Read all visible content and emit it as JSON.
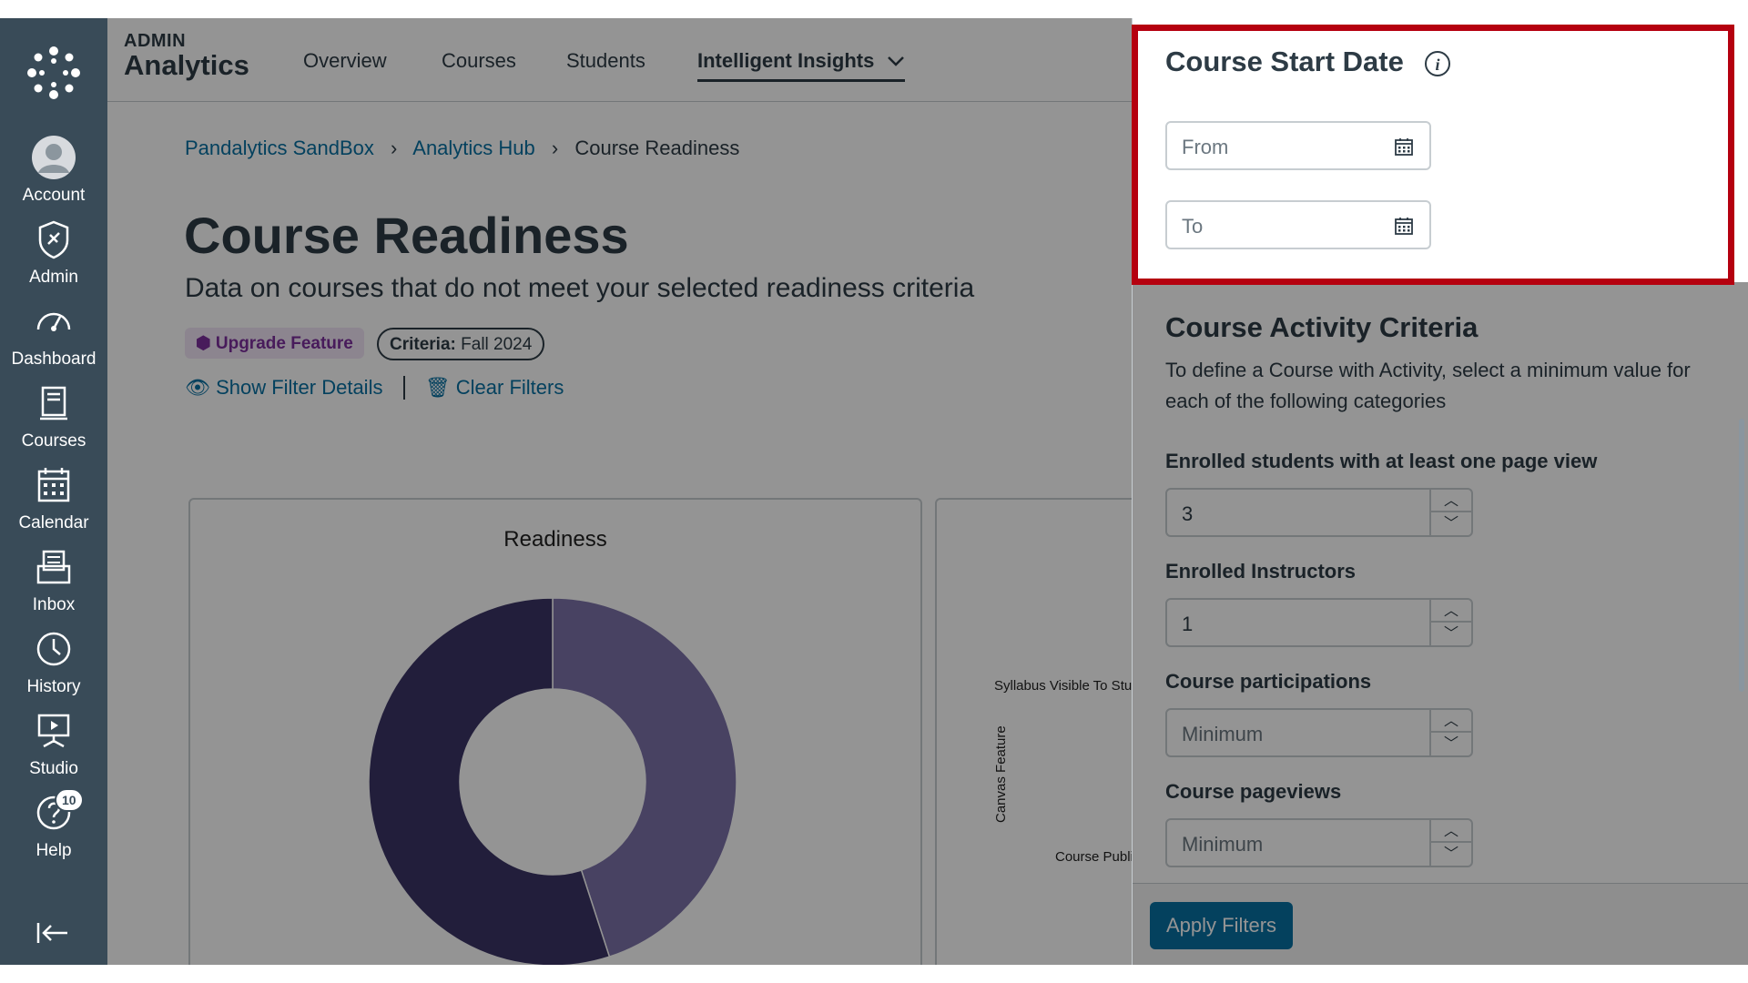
{
  "nav": {
    "items": [
      {
        "label": "Account",
        "icon": "account-icon"
      },
      {
        "label": "Admin",
        "icon": "admin-icon"
      },
      {
        "label": "Dashboard",
        "icon": "dashboard-icon"
      },
      {
        "label": "Courses",
        "icon": "courses-icon"
      },
      {
        "label": "Calendar",
        "icon": "calendar-icon"
      },
      {
        "label": "Inbox",
        "icon": "inbox-icon"
      },
      {
        "label": "History",
        "icon": "history-icon"
      },
      {
        "label": "Studio",
        "icon": "studio-icon"
      },
      {
        "label": "Help",
        "icon": "help-icon",
        "badge": "10"
      }
    ]
  },
  "header": {
    "brand_small": "ADMIN",
    "brand_big": "Analytics",
    "tabs": [
      "Overview",
      "Courses",
      "Students",
      "Intelligent Insights"
    ]
  },
  "breadcrumb": [
    "Pandalytics SandBox",
    "Analytics Hub",
    "Course Readiness"
  ],
  "page": {
    "title": "Course Readiness",
    "subtitle": "Data on courses that do not meet your selected readiness criteria",
    "upgrade_label": "Upgrade Feature",
    "criteria_label": "Criteria:",
    "criteria_value": "Fall 2024",
    "show_filter": "Show Filter Details",
    "clear_filters": "Clear Filters"
  },
  "chart1": {
    "title": "Readiness"
  },
  "chart2": {
    "axis_label": "Canvas Feature",
    "label_1": "Syllabus Visible To Stuc",
    "label_2": "Course Publi"
  },
  "chart_data": {
    "type": "pie",
    "title": "Readiness",
    "values": [
      45,
      55
    ],
    "colors": [
      "#7c72aa",
      "#3b3466"
    ]
  },
  "panel": {
    "date_title": "Course Start Date",
    "from_placeholder": "From",
    "to_placeholder": "To",
    "activity_title": "Course Activity Criteria",
    "activity_desc": "To define a Course with Activity, select a minimum value for each of the following categories",
    "fields": [
      {
        "label": "Enrolled students with at least one page view",
        "value": "3",
        "placeholder": "Minimum"
      },
      {
        "label": "Enrolled Instructors",
        "value": "1",
        "placeholder": "Minimum"
      },
      {
        "label": "Course participations",
        "value": "",
        "placeholder": "Minimum"
      },
      {
        "label": "Course pageviews",
        "value": "",
        "placeholder": "Minimum"
      }
    ],
    "apply_label": "Apply Filters"
  },
  "colors": {
    "nav_bg": "#394b58",
    "highlight": "#b5000f",
    "link": "#0770a3"
  }
}
